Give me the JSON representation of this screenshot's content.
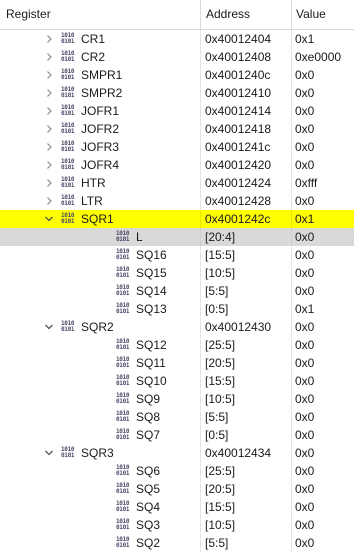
{
  "columns": {
    "register": "Register",
    "address": "Address",
    "value": "Value"
  },
  "icon": {
    "line1": "1010",
    "line2": "0101"
  },
  "rows": [
    {
      "name": "CR1",
      "address": "0x40012404",
      "value": "0x1",
      "level": 0,
      "expander": "collapsed"
    },
    {
      "name": "CR2",
      "address": "0x40012408",
      "value": "0xe0000",
      "level": 0,
      "expander": "collapsed"
    },
    {
      "name": "SMPR1",
      "address": "0x4001240c",
      "value": "0x0",
      "level": 0,
      "expander": "collapsed"
    },
    {
      "name": "SMPR2",
      "address": "0x40012410",
      "value": "0x0",
      "level": 0,
      "expander": "collapsed"
    },
    {
      "name": "JOFR1",
      "address": "0x40012414",
      "value": "0x0",
      "level": 0,
      "expander": "collapsed"
    },
    {
      "name": "JOFR2",
      "address": "0x40012418",
      "value": "0x0",
      "level": 0,
      "expander": "collapsed"
    },
    {
      "name": "JOFR3",
      "address": "0x4001241c",
      "value": "0x0",
      "level": 0,
      "expander": "collapsed"
    },
    {
      "name": "JOFR4",
      "address": "0x40012420",
      "value": "0x0",
      "level": 0,
      "expander": "collapsed"
    },
    {
      "name": "HTR",
      "address": "0x40012424",
      "value": "0xfff",
      "level": 0,
      "expander": "collapsed"
    },
    {
      "name": "LTR",
      "address": "0x40012428",
      "value": "0x0",
      "level": 0,
      "expander": "collapsed"
    },
    {
      "name": "SQR1",
      "address": "0x4001242c",
      "value": "0x1",
      "level": 0,
      "expander": "expanded",
      "state": "selected"
    },
    {
      "name": "L",
      "address": "[20:4]",
      "value": "0x0",
      "level": 1,
      "state": "hover"
    },
    {
      "name": "SQ16",
      "address": "[15:5]",
      "value": "0x0",
      "level": 1
    },
    {
      "name": "SQ15",
      "address": "[10:5]",
      "value": "0x0",
      "level": 1
    },
    {
      "name": "SQ14",
      "address": "[5:5]",
      "value": "0x0",
      "level": 1
    },
    {
      "name": "SQ13",
      "address": "[0:5]",
      "value": "0x1",
      "level": 1
    },
    {
      "name": "SQR2",
      "address": "0x40012430",
      "value": "0x0",
      "level": 0,
      "expander": "expanded"
    },
    {
      "name": "SQ12",
      "address": "[25:5]",
      "value": "0x0",
      "level": 1
    },
    {
      "name": "SQ11",
      "address": "[20:5]",
      "value": "0x0",
      "level": 1
    },
    {
      "name": "SQ10",
      "address": "[15:5]",
      "value": "0x0",
      "level": 1
    },
    {
      "name": "SQ9",
      "address": "[10:5]",
      "value": "0x0",
      "level": 1
    },
    {
      "name": "SQ8",
      "address": "[5:5]",
      "value": "0x0",
      "level": 1
    },
    {
      "name": "SQ7",
      "address": "[0:5]",
      "value": "0x0",
      "level": 1
    },
    {
      "name": "SQR3",
      "address": "0x40012434",
      "value": "0x0",
      "level": 0,
      "expander": "expanded"
    },
    {
      "name": "SQ6",
      "address": "[25:5]",
      "value": "0x0",
      "level": 1
    },
    {
      "name": "SQ5",
      "address": "[20:5]",
      "value": "0x0",
      "level": 1
    },
    {
      "name": "SQ4",
      "address": "[15:5]",
      "value": "0x0",
      "level": 1
    },
    {
      "name": "SQ3",
      "address": "[10:5]",
      "value": "0x0",
      "level": 1
    },
    {
      "name": "SQ2",
      "address": "[5:5]",
      "value": "0x0",
      "level": 1
    }
  ],
  "colors": {
    "selected": "#ffff00",
    "hover": "#d9d9d9"
  }
}
